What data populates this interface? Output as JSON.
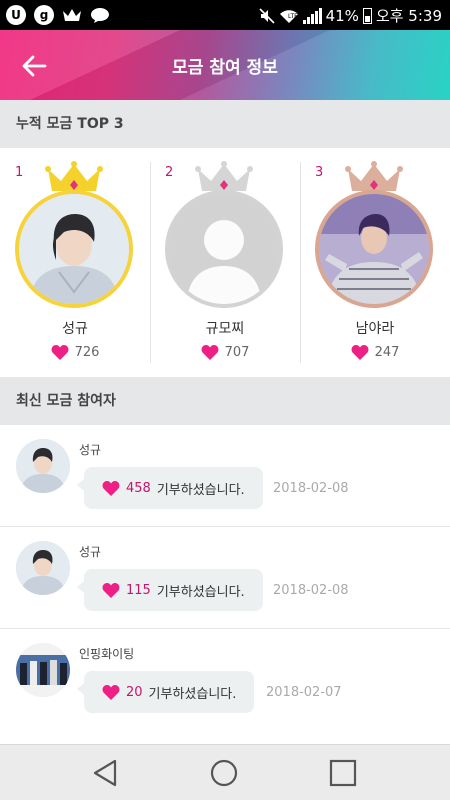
{
  "status_bar": {
    "battery": "41%",
    "clock": "오후 5:39",
    "icons": [
      "u-app-icon",
      "g-app-icon",
      "crown-app-icon",
      "chat-bubble-icon",
      "mute-icon",
      "wifi-icon",
      "signal-icon",
      "battery-icon"
    ]
  },
  "header": {
    "title": "모금 참여 정보",
    "back_icon": "arrow-left-icon"
  },
  "top3": {
    "section_title": "누적 모금 TOP 3",
    "ranks": [
      {
        "rank": "1",
        "name": "성규",
        "likes": "726",
        "crown_color": "#f5d12b",
        "ring_color": "#f6d33a"
      },
      {
        "rank": "2",
        "name": "규모찌",
        "likes": "707",
        "crown_color": "#d5d5d5",
        "ring_color": "#d3d3d3"
      },
      {
        "rank": "3",
        "name": "남야라",
        "likes": "247",
        "crown_color": "#dcae9c",
        "ring_color": "#d8a691"
      }
    ]
  },
  "recent": {
    "section_title": "최신 모금 참여자",
    "items": [
      {
        "name": "성규",
        "amount": "458",
        "text": "기부하셨습니다.",
        "date": "2018-02-08"
      },
      {
        "name": "성규",
        "amount": "115",
        "text": "기부하셨습니다.",
        "date": "2018-02-08"
      },
      {
        "name": "인핑화이팅",
        "amount": "20",
        "text": "기부하셨습니다.",
        "date": "2018-02-07"
      }
    ]
  },
  "colors": {
    "accent_pink": "#ee1f85",
    "amount_text": "#c4166e",
    "section_bg": "#e6e7e8"
  }
}
